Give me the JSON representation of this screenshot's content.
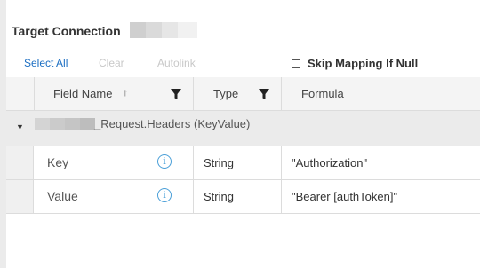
{
  "panel": {
    "title": "Target Connection"
  },
  "toolbar": {
    "select_all": "Select All",
    "clear": "Clear",
    "autolink": "Autolink",
    "skip_mapping": "Skip Mapping If Null"
  },
  "grid": {
    "columns": {
      "field_name": "Field Name",
      "type": "Type",
      "formula": "Formula"
    },
    "sort_icon": "arrow-up-icon",
    "filter_icon": "funnel-icon",
    "group": {
      "caret_icon": "caret-down-icon",
      "label": "_Request.Headers (KeyValue)"
    },
    "rows": [
      {
        "field": "Key",
        "type": "String",
        "formula": "\"Authorization\""
      },
      {
        "field": "Value",
        "type": "String",
        "formula": "\"Bearer [authToken]\""
      }
    ]
  },
  "colors": {
    "link": "#1b6ec2",
    "disabled": "#c8c8c8",
    "info_icon": "#4a9fd8",
    "header_bg": "#f4f4f4",
    "group_bg": "#ebebeb"
  }
}
